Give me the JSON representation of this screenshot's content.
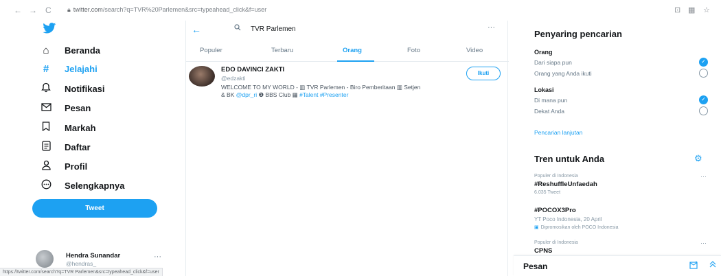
{
  "browser": {
    "back": "←",
    "forward": "→",
    "reload": "C",
    "url_domain": "twitter.com",
    "url_path": "/search?q=TVR%20Parlemen&src=typeahead_click&f=user",
    "icons": [
      "zoom-icon",
      "extensions-icon",
      "star-icon"
    ]
  },
  "nav": {
    "items": [
      {
        "label": "Beranda",
        "icon": "home-icon",
        "glyph": "⌂"
      },
      {
        "label": "Jelajahi",
        "icon": "hashtag-icon",
        "glyph": "#"
      },
      {
        "label": "Notifikasi",
        "icon": "bell-icon",
        "glyph": "🔔︎"
      },
      {
        "label": "Pesan",
        "icon": "envelope-icon",
        "glyph": "✉"
      },
      {
        "label": "Markah",
        "icon": "bookmark-icon",
        "glyph": "⌑"
      },
      {
        "label": "Daftar",
        "icon": "list-icon",
        "glyph": "▤"
      },
      {
        "label": "Profil",
        "icon": "profile-icon",
        "glyph": "♙"
      },
      {
        "label": "Selengkapnya",
        "icon": "more-circle-icon",
        "glyph": "⋯"
      }
    ],
    "active_index": 1,
    "tweet_label": "Tweet",
    "accent": "#1da1f2"
  },
  "profile": {
    "name": "Hendra Sunandar",
    "handle": "@hendras_",
    "more": "···"
  },
  "status_url": "https://twitter.com/search?q=TVR Parlemen&src=typeahead_click&f=user",
  "search": {
    "back": "←",
    "query": "TVR Parlemen",
    "more": "···",
    "tabs": [
      "Populer",
      "Terbaru",
      "Orang",
      "Foto",
      "Video"
    ],
    "active_tab": 2
  },
  "result": {
    "name": "EDO DAVINCI ZAKTI",
    "handle": "@edzakti",
    "bio_line1_text": "WELCOME TO MY WORLD - ▥ TVR Parlemen - Biro Pemberitaan ▥ Setjen",
    "bio_line2_pre": "& BK ",
    "bio_mention": "@dpr_ri",
    "bio_mid": " ❶ BBS Club ▦ ",
    "bio_tags": "#Talent #Presenter",
    "follow_label": "Ikuti"
  },
  "filters": {
    "title": "Penyaring pencarian",
    "people_label": "Orang",
    "people_opts": [
      "Dari siapa pun",
      "Orang yang Anda ikuti"
    ],
    "people_selected": 0,
    "location_label": "Lokasi",
    "location_opts": [
      "Di mana pun",
      "Dekat Anda"
    ],
    "location_selected": 0,
    "advanced_link": "Pencarian lanjutan"
  },
  "trends": {
    "title": "Tren untuk Anda",
    "items": [
      {
        "meta": "Populer di Indonesia",
        "name": "#ReshuffleUnfaedah",
        "sub": "6.035 Tweet",
        "more": "···"
      },
      {
        "meta": "",
        "name": "#POCOX3Pro",
        "sub": "YT Poco Indonesia, 20 April",
        "promo": "Dipromosikan oleh POCO Indonesia",
        "more": ""
      },
      {
        "meta": "Populer di Indonesia",
        "name": "CPNS",
        "sub": "",
        "more": "···"
      }
    ]
  },
  "messages": {
    "title": "Pesan"
  }
}
